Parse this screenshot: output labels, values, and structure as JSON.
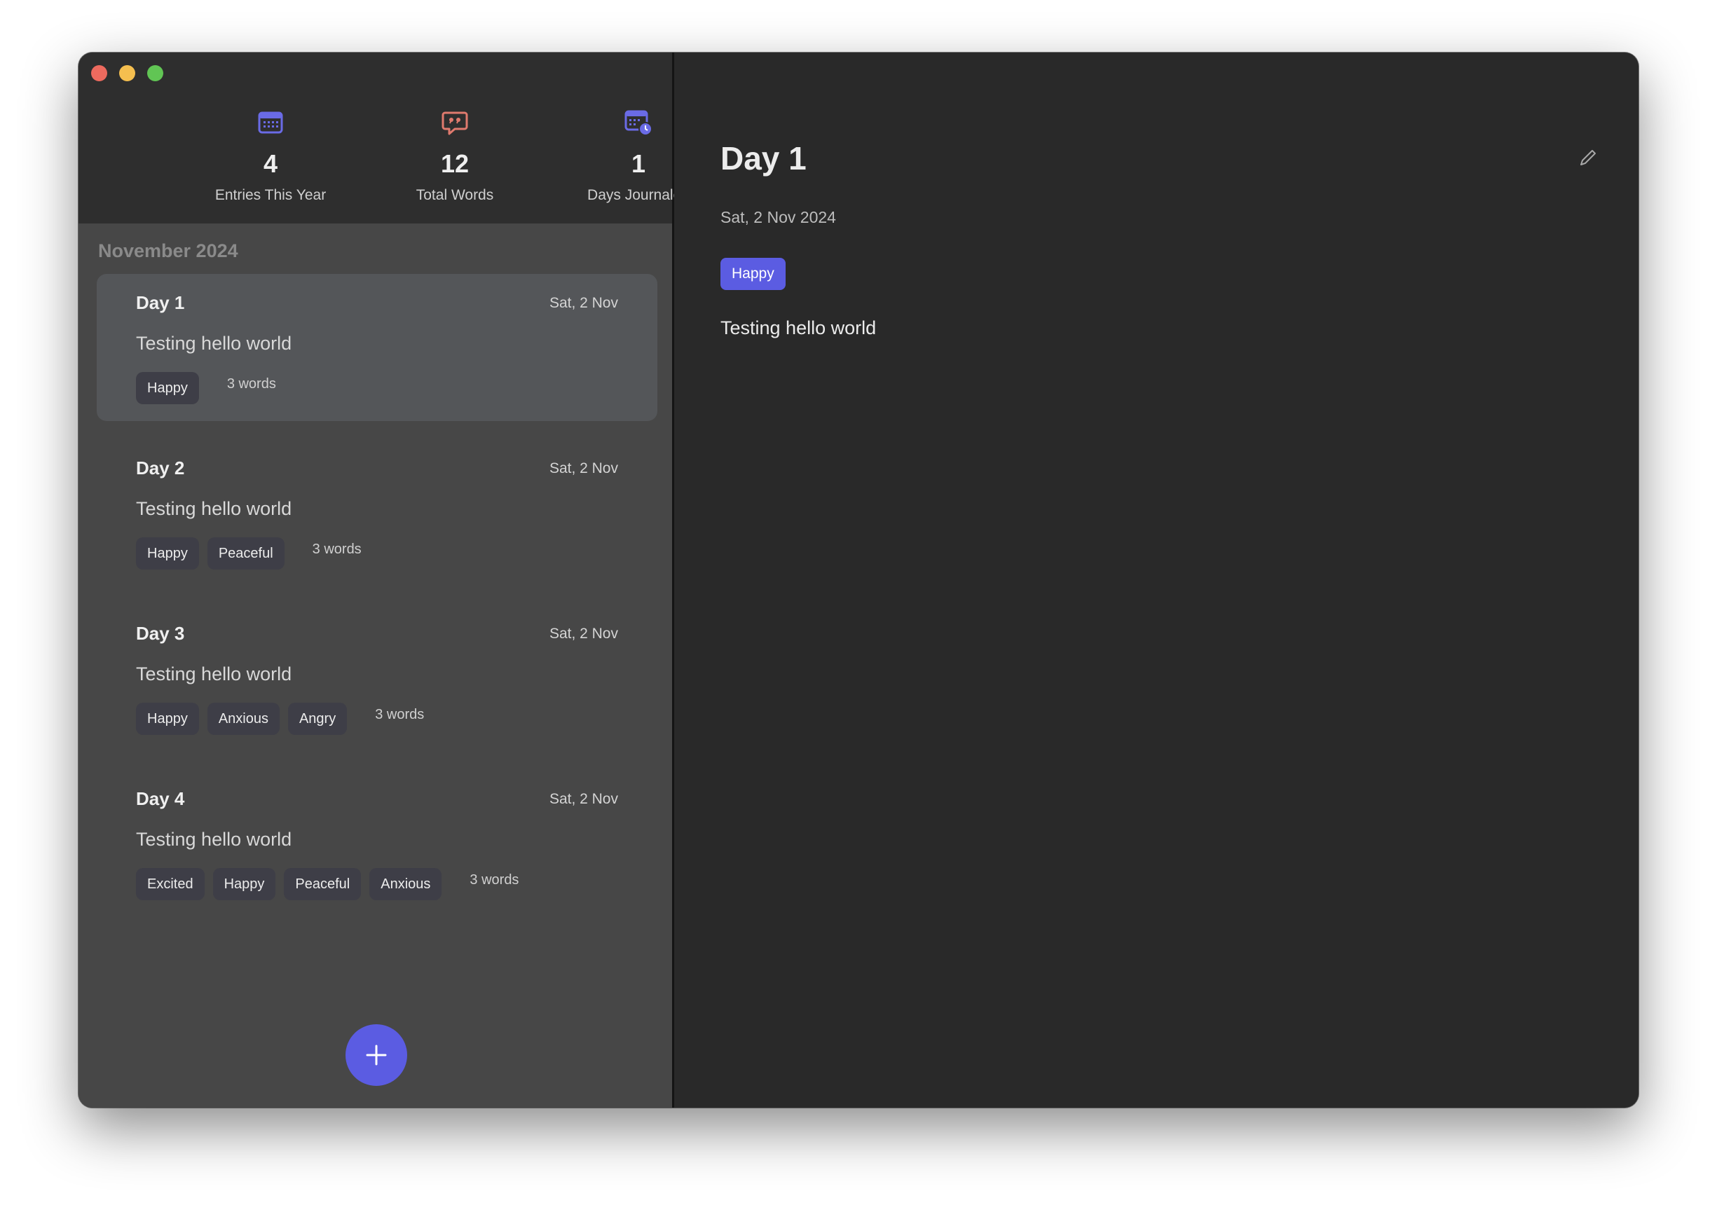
{
  "colors": {
    "accent": "#5b5ce2",
    "calendar_icon": "#6a6be6",
    "words_icon": "#e07a6e"
  },
  "stats": [
    {
      "icon": "calendar-icon",
      "value": "4",
      "label": "Entries This Year"
    },
    {
      "icon": "speech-bubble-quote-icon",
      "value": "12",
      "label": "Total Words"
    },
    {
      "icon": "calendar-clock-icon",
      "value": "1",
      "label": "Days Journaled"
    }
  ],
  "sidebar": {
    "month_header": "November 2024",
    "entries": [
      {
        "title": "Day 1",
        "date": "Sat, 2 Nov",
        "snippet": "Testing hello world",
        "tags": [
          "Happy"
        ],
        "words": "3 words",
        "selected": true
      },
      {
        "title": "Day 2",
        "date": "Sat, 2 Nov",
        "snippet": "Testing hello world",
        "tags": [
          "Happy",
          "Peaceful"
        ],
        "words": "3 words",
        "selected": false
      },
      {
        "title": "Day 3",
        "date": "Sat, 2 Nov",
        "snippet": "Testing hello world",
        "tags": [
          "Happy",
          "Anxious",
          "Angry"
        ],
        "words": "3 words",
        "selected": false
      },
      {
        "title": "Day 4",
        "date": "Sat, 2 Nov",
        "snippet": "Testing hello world",
        "tags": [
          "Excited",
          "Happy",
          "Peaceful",
          "Anxious"
        ],
        "words": "3 words",
        "selected": false
      }
    ],
    "add_button_icon": "plus-icon"
  },
  "detail": {
    "title": "Day 1",
    "date": "Sat, 2 Nov 2024",
    "tag": "Happy",
    "body": "Testing hello world",
    "edit_icon": "pencil-icon"
  }
}
